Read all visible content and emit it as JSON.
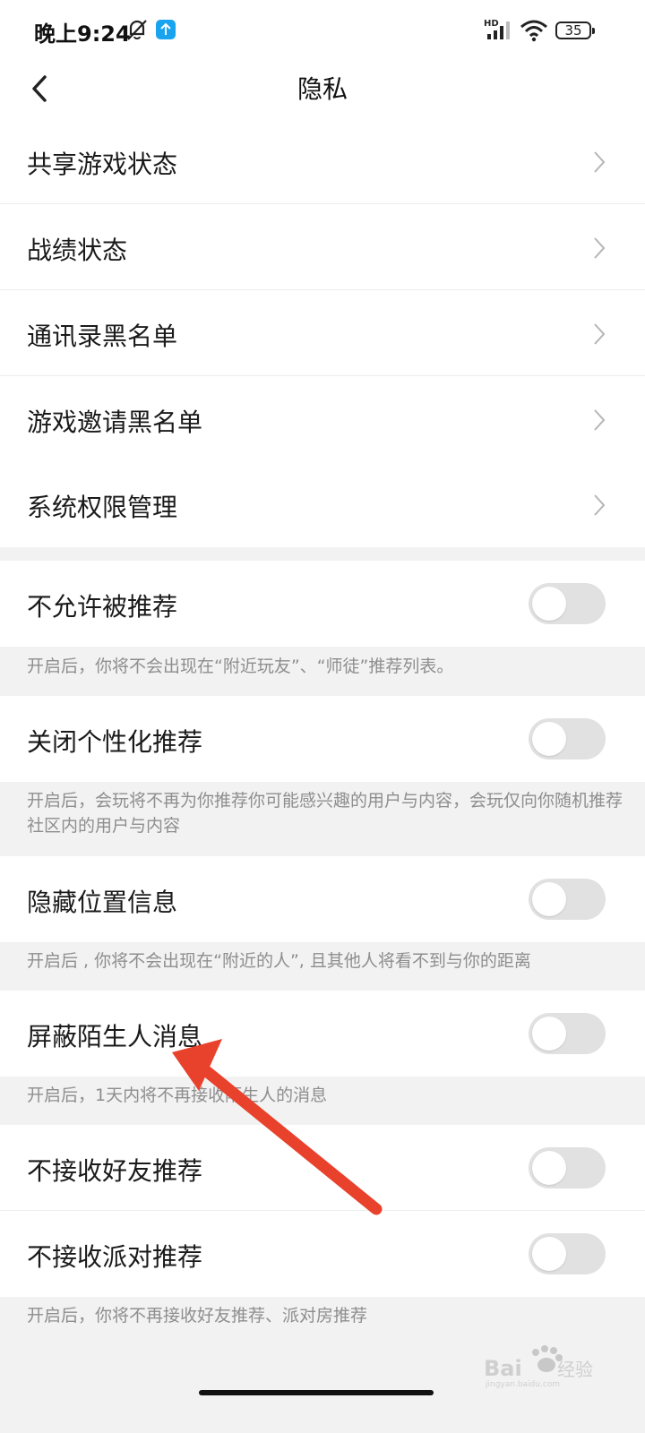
{
  "status_bar": {
    "time": "晚上9:24",
    "battery": "35",
    "icons": [
      "bell-muted-icon",
      "upload-icon",
      "hd-signal-icon",
      "wifi-icon",
      "battery-icon"
    ]
  },
  "header": {
    "title": "隐私",
    "back_icon": "chevron-left-icon"
  },
  "nav_items": [
    {
      "label": "共享游戏状态"
    },
    {
      "label": "战绩状态"
    },
    {
      "label": "通讯录黑名单"
    },
    {
      "label": "游戏邀请黑名单"
    },
    {
      "label": "系统权限管理"
    }
  ],
  "toggles": [
    {
      "label": "不允许被推荐",
      "on": false
    },
    {
      "label": "关闭个性化推荐",
      "on": false
    },
    {
      "label": "隐藏位置信息",
      "on": false
    },
    {
      "label": "屏蔽陌生人消息",
      "on": false
    },
    {
      "label": "不接收好友推荐",
      "on": false
    },
    {
      "label": "不接收派对推荐",
      "on": false
    }
  ],
  "descriptions": [
    "开启后，你将不会出现在“附近玩友”、“师徒”推荐列表。",
    "开启后，会玩将不再为你推荐你可能感兴趣的用户与内容，会玩仅向你随机推荐社区内的用户与内容",
    "开启后 , 你将不会出现在“附近的人”, 且其他人将看不到与你的距离",
    "开启后，1天内将不再接收陌生人的消息",
    "开启后，你将不再接收好友推荐、派对房推荐"
  ],
  "watermark": {
    "text": "Bai du 经验",
    "sub": "jingyan.baidu.com"
  },
  "colors": {
    "accent_arrow": "#e8412c",
    "toggle_off": "#e1e1e1",
    "badge": "#1aa3ef"
  }
}
